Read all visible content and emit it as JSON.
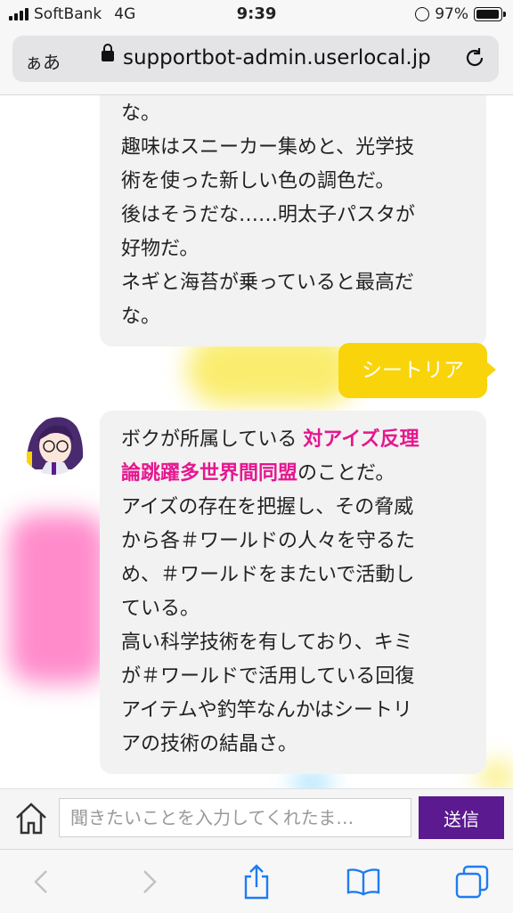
{
  "status_bar": {
    "carrier": "SoftBank",
    "network": "4G",
    "time": "9:39",
    "battery": "97%",
    "battery_level": 0.97
  },
  "browser": {
    "text_size_label": "ぁあ",
    "url": "supportbot-admin.userlocal.jp"
  },
  "chat": {
    "messages": [
      {
        "role": "bot",
        "lines": [
          "な。",
          "趣味はスニーカー集めと、光学技",
          "術を使った新しい色の調色だ。",
          "後はそうだな……明太子パスタが",
          "好物だ。",
          "ネギと海苔が乗っていると最高だ",
          "な。"
        ]
      },
      {
        "role": "user",
        "text": "シートリア"
      },
      {
        "role": "bot",
        "line1_pre": "ボクが所属している ",
        "line1_hl": "対アイズ反理",
        "line2_hl": "論跳躍多世界間同盟",
        "line2_post": "のことだ。",
        "lines": [
          "アイズの存在を把握し、その脅威",
          "から各＃ワールドの人々を守るた",
          "め、＃ワールドをまたいで活動し",
          "ている。",
          "高い科学技術を有しており、キミ",
          "が＃ワールドで活用している回復",
          "アイテムや釣竿なんかはシートリ",
          "アの技術の結晶さ。"
        ]
      }
    ]
  },
  "input": {
    "placeholder": "聞きたいことを入力してくれたま…",
    "value": "",
    "send_label": "送信"
  },
  "icons": {
    "home": "home-icon",
    "back": "chevron-left-icon",
    "forward": "chevron-right-icon",
    "share": "share-icon",
    "bookmarks": "book-icon",
    "tabs": "tabs-icon",
    "reload": "reload-icon",
    "lock": "lock-icon"
  },
  "colors": {
    "user_bubble": "#f9d40a",
    "highlight": "#e5178f",
    "send_button": "#5b1a8f"
  }
}
